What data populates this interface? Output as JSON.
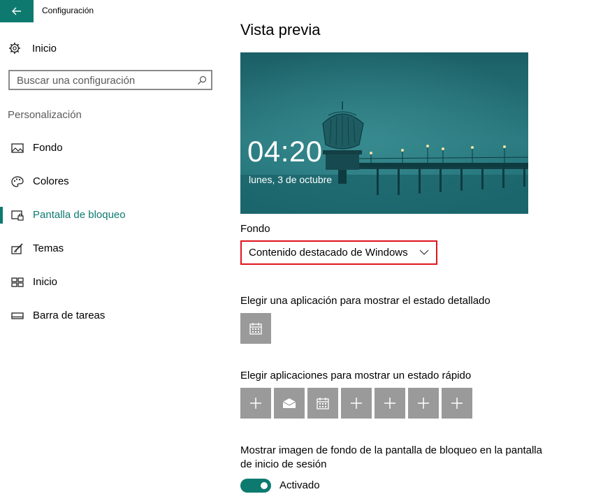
{
  "window": {
    "title": "Configuración"
  },
  "sidebar": {
    "home_label": "Inicio",
    "search_placeholder": "Buscar una configuración",
    "section_title": "Personalización",
    "items": [
      {
        "label": "Fondo",
        "icon": "picture-icon"
      },
      {
        "label": "Colores",
        "icon": "palette-icon"
      },
      {
        "label": "Pantalla de bloqueo",
        "icon": "lock-screen-icon",
        "active": true
      },
      {
        "label": "Temas",
        "icon": "themes-icon"
      },
      {
        "label": "Inicio",
        "icon": "start-icon"
      },
      {
        "label": "Barra de tareas",
        "icon": "taskbar-icon"
      }
    ]
  },
  "main": {
    "title": "Vista previa",
    "preview": {
      "time": "04:20",
      "date": "lunes, 3 de octubre"
    },
    "background": {
      "label": "Fondo",
      "selected": "Contenido destacado de Windows"
    },
    "detailed_status": {
      "label": "Elegir una aplicación para mostrar el estado detallado",
      "apps": [
        "calendar-icon"
      ]
    },
    "quick_status": {
      "label": "Elegir aplicaciones para mostrar un estado rápido",
      "apps": [
        "plus-icon",
        "mail-icon",
        "calendar-icon",
        "plus-icon",
        "plus-icon",
        "plus-icon",
        "plus-icon"
      ]
    },
    "signin_background": {
      "label_line1": "Mostrar imagen de fondo de la pantalla de bloqueo en la pantalla",
      "label_line2": "de inicio de sesión",
      "toggle_state": "Activado",
      "on": true
    }
  },
  "colors": {
    "accent": "#0e7a6f",
    "highlight_border": "#e0141e",
    "tile": "#9a9a9a"
  }
}
